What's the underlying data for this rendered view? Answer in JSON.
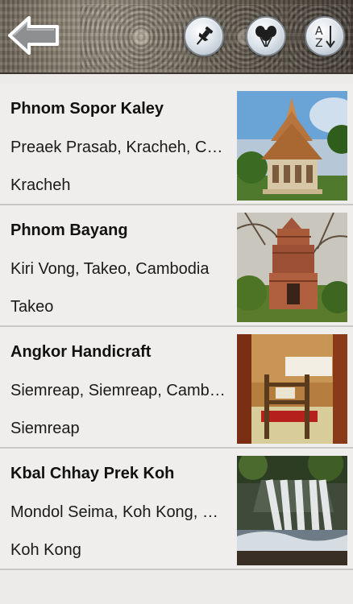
{
  "toolbar": {
    "back_icon": "back-arrow-icon",
    "pin_icon": "pushpin-icon",
    "balloons_icon": "balloons-icon",
    "sort_icon": "sort-az-icon",
    "sort_letter_top": "A",
    "sort_letter_bottom": "Z"
  },
  "places": [
    {
      "name": "Phnom Sopor Kaley",
      "address": "Preaek Prasab, Kracheh, Cambodia",
      "region": "Kracheh",
      "photo": "pagoda-photo"
    },
    {
      "name": "Phnom Bayang",
      "address": "Kiri Vong, Takeo, Cambodia",
      "region": "Takeo",
      "photo": "brick-tower-photo"
    },
    {
      "name": "Angkor Handicraft",
      "address": "Siemreap, Siemreap, Cambodia",
      "region": "Siemreap",
      "photo": "weaving-loom-photo"
    },
    {
      "name": "Kbal Chhay Prek Koh",
      "address": " Mondol Seima, Koh Kong, Cambodia",
      "region": "Koh Kong",
      "photo": "waterfall-photo"
    }
  ],
  "colors": {
    "row_background": "#efeeec",
    "separator": "#c9c8c5",
    "button_border": "#7d858d"
  }
}
